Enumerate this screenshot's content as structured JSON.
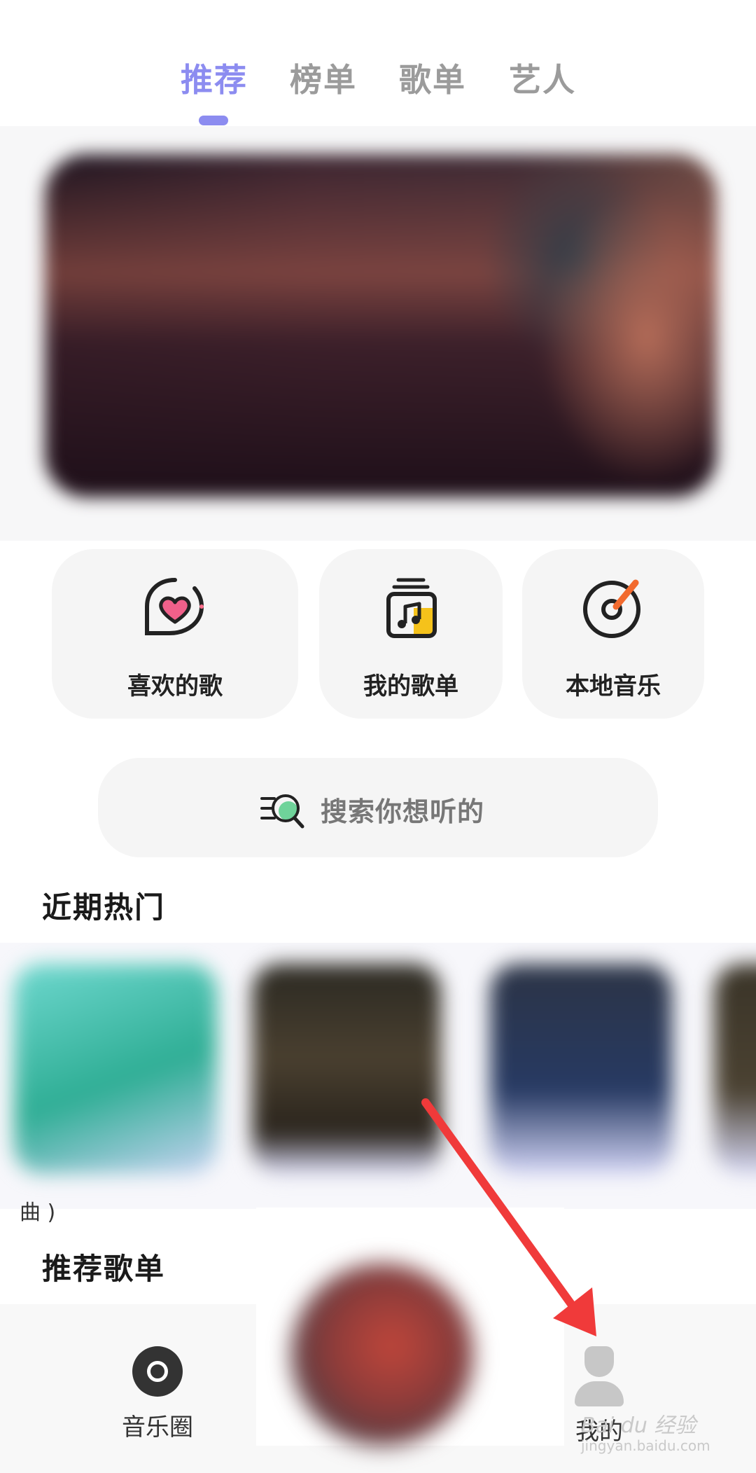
{
  "tabs": [
    {
      "label": "推荐",
      "active": true
    },
    {
      "label": "榜单",
      "active": false
    },
    {
      "label": "歌单",
      "active": false
    },
    {
      "label": "艺人",
      "active": false
    }
  ],
  "accent_color": "#8c8cf0",
  "quick_cards": [
    {
      "label": "喜欢的歌",
      "icon": "heart-chat-icon"
    },
    {
      "label": "我的歌单",
      "icon": "music-note-jar-icon"
    },
    {
      "label": "本地音乐",
      "icon": "vinyl-disc-icon"
    }
  ],
  "search": {
    "placeholder": "搜索你想听的",
    "icon": "search-list-icon"
  },
  "sections": {
    "hot": "近期热门",
    "recommended": "推荐歌单",
    "hot_caption_fragment": "曲 )"
  },
  "bottom_nav": {
    "left": {
      "label": "音乐圈",
      "icon": "circle-icon"
    },
    "right": {
      "label": "我的",
      "icon": "user-avatar-icon"
    }
  },
  "watermark": {
    "main": "Bai du 经验",
    "sub": "jingyan.baidu.com"
  }
}
